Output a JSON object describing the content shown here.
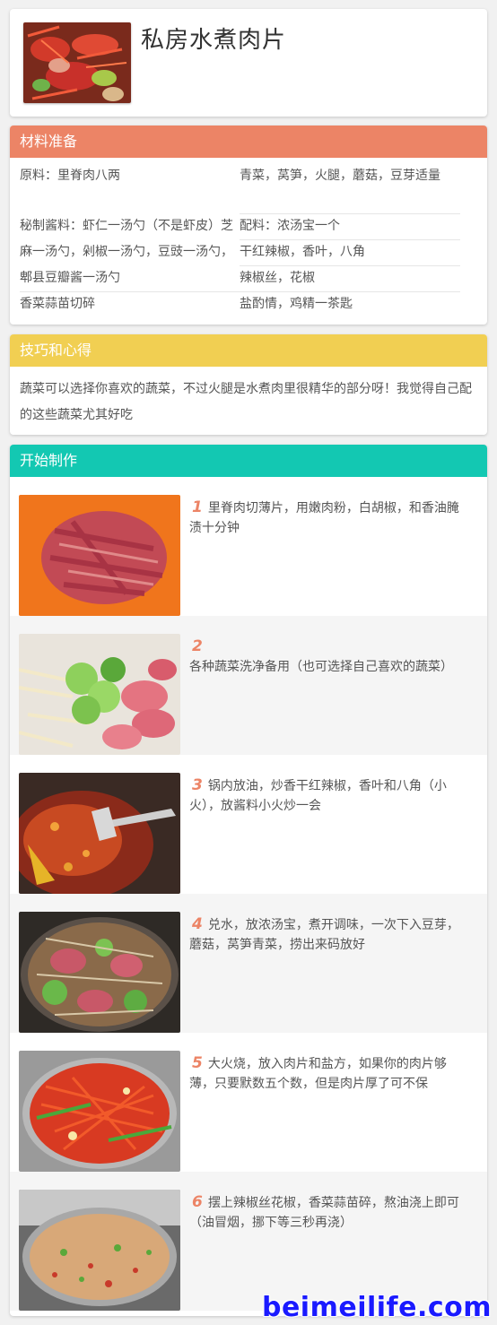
{
  "recipe": {
    "title": "私房水煮肉片"
  },
  "ingredients": {
    "header": "材料准备",
    "rows": [
      {
        "left": "原料：里脊肉八两",
        "right": "青菜，莴笋，火腿，蘑菇，豆芽适量"
      },
      {
        "left": "秘制酱料：虾仁一汤勺（不是虾皮）芝麻一汤勺，剁椒一汤勺，豆豉一汤勺，郫县豆瓣酱一汤勺",
        "right": "配料：浓汤宝一个"
      },
      {
        "right": "干红辣椒，香叶，八角"
      },
      {
        "right": "辣椒丝，花椒"
      },
      {
        "left": "香菜蒜苗切碎",
        "right": "盐酌情，鸡精一茶匙"
      }
    ]
  },
  "tips": {
    "header": "技巧和心得",
    "text": "蔬菜可以选择你喜欢的蔬菜，不过火腿是水煮肉里很精华的部分呀！我觉得自己配的这些蔬菜尤其好吃"
  },
  "steps": {
    "header": "开始制作",
    "items": [
      {
        "num": "1",
        "text": "里脊肉切薄片，用嫩肉粉，白胡椒，和香油腌渍十分钟"
      },
      {
        "num": "2",
        "text": "各种蔬菜洗净备用（也可选择自己喜欢的蔬菜）"
      },
      {
        "num": "3",
        "text": "锅内放油，炒香干红辣椒，香叶和八角（小火），放酱料小火炒一会"
      },
      {
        "num": "4",
        "text": "兑水，放浓汤宝，煮开调味，一次下入豆芽，蘑菇，莴笋青菜，捞出来码放好"
      },
      {
        "num": "5",
        "text": "大火烧，放入肉片和盐方，如果你的肉片够薄，只要默数五个数，但是肉片厚了可不保"
      },
      {
        "num": "6",
        "text": "摆上辣椒丝花椒，香菜蒜苗碎，熬油浇上即可（油冒烟，挪下等三秒再浇）"
      }
    ]
  },
  "watermark": "beimeilife.com",
  "colors": {
    "ingredients_header": "#ec8466",
    "tips_header": "#f1cf52",
    "steps_header": "#13c8b2",
    "step_number": "#ec8466",
    "watermark": "#1a1aff"
  }
}
